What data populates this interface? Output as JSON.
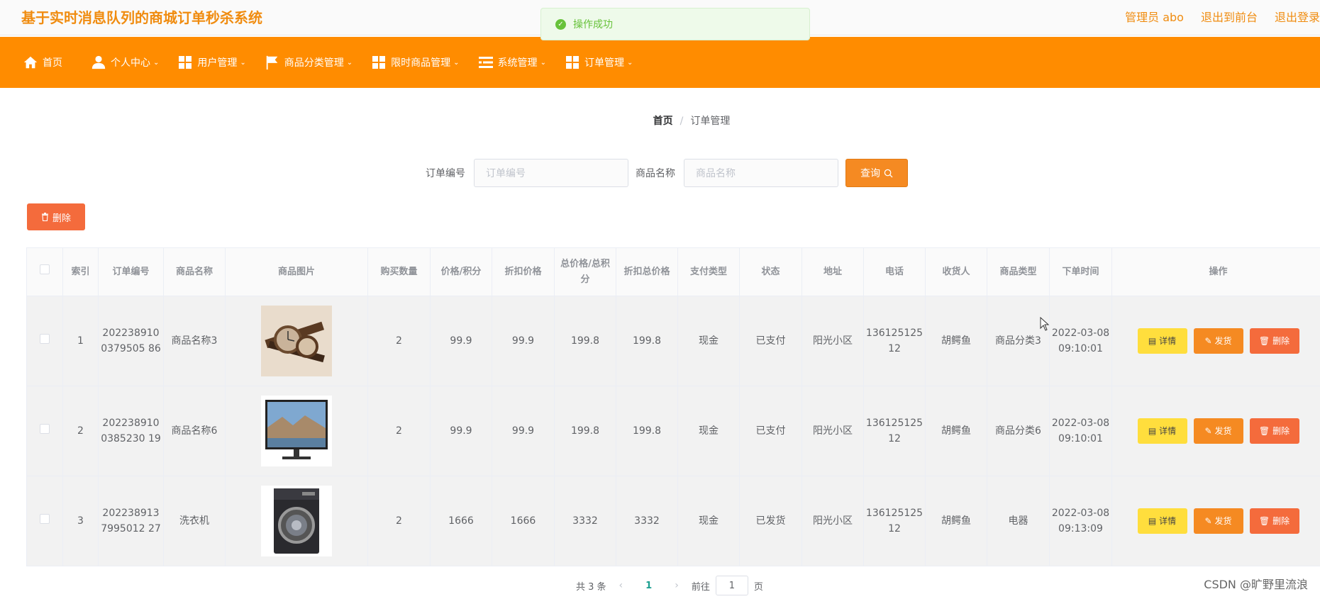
{
  "header": {
    "title": "基于实时消息队列的商城订单秒杀系统",
    "links": [
      "管理员 abo",
      "退出到前台",
      "退出登录"
    ]
  },
  "toast": {
    "message": "操作成功"
  },
  "nav": [
    {
      "label": "首页",
      "icon": "home-icon",
      "has_menu": false
    },
    {
      "label": "个人中心",
      "icon": "user-icon",
      "has_menu": true
    },
    {
      "label": "用户管理",
      "icon": "grid-icon",
      "has_menu": true
    },
    {
      "label": "商品分类管理",
      "icon": "flag-icon",
      "has_menu": true
    },
    {
      "label": "限时商品管理",
      "icon": "grid-icon",
      "has_menu": true
    },
    {
      "label": "系统管理",
      "icon": "list-icon",
      "has_menu": true
    },
    {
      "label": "订单管理",
      "icon": "grid-icon",
      "has_menu": true
    }
  ],
  "breadcrumb": {
    "home": "首页",
    "separator": "/",
    "current": "订单管理"
  },
  "search": {
    "order_no_label": "订单编号",
    "order_no_placeholder": "订单编号",
    "product_label": "商品名称",
    "product_placeholder": "商品名称",
    "query_label": "查询"
  },
  "delete_label": "删除",
  "table": {
    "columns": [
      "索引",
      "订单编号",
      "商品名称",
      "商品图片",
      "购买数量",
      "价格/积分",
      "折扣价格",
      "总价格/总积分",
      "折扣总价格",
      "支付类型",
      "状态",
      "地址",
      "电话",
      "收货人",
      "商品类型",
      "下单时间",
      "操作"
    ],
    "rows": [
      {
        "index": "1",
        "order_no": "2022389100379505 86",
        "name": "商品名称3",
        "image": "watch",
        "qty": "2",
        "price": "99.9",
        "discount": "99.9",
        "total": "199.8",
        "discount_total": "199.8",
        "pay": "现金",
        "status": "已支付",
        "address": "阳光小区",
        "phone": "13612512512",
        "receiver": "胡鳄鱼",
        "type": "商品分类3",
        "time": "2022-03-08 09:10:01"
      },
      {
        "index": "2",
        "order_no": "2022389100385230 19",
        "name": "商品名称6",
        "image": "tv",
        "qty": "2",
        "price": "99.9",
        "discount": "99.9",
        "total": "199.8",
        "discount_total": "199.8",
        "pay": "现金",
        "status": "已支付",
        "address": "阳光小区",
        "phone": "13612512512",
        "receiver": "胡鳄鱼",
        "type": "商品分类6",
        "time": "2022-03-08 09:10:01"
      },
      {
        "index": "3",
        "order_no": "2022389137995012 27",
        "name": "洗衣机",
        "image": "washer",
        "qty": "2",
        "price": "1666",
        "discount": "1666",
        "total": "3332",
        "discount_total": "3332",
        "pay": "现金",
        "status": "已发货",
        "address": "阳光小区",
        "phone": "13612512512",
        "receiver": "胡鳄鱼",
        "type": "电器",
        "time": "2022-03-08 09:13:09"
      }
    ],
    "actions": {
      "detail": "详情",
      "ship": "发货",
      "delete": "删除"
    }
  },
  "pagination": {
    "total_text": "共 3 条",
    "current": "1",
    "goto_label": "前往",
    "goto_value": "1",
    "page_suffix": "页"
  },
  "watermark": "CSDN @旷野里流浪",
  "colors": {
    "accent": "#ff8c00",
    "success": "#67c23a",
    "danger": "#f46b3c",
    "warning": "#ffde3d"
  }
}
